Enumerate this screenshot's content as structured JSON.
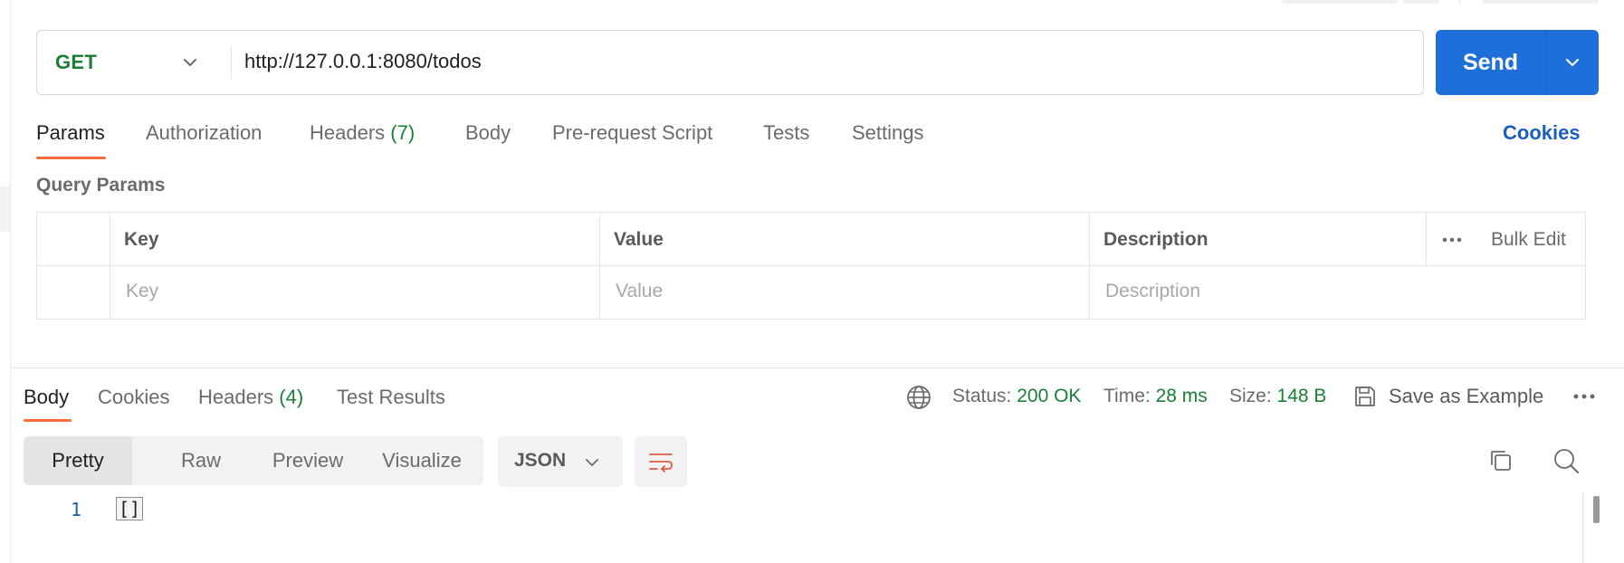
{
  "request": {
    "method": "GET",
    "url": "http://127.0.0.1:8080/todos",
    "send_label": "Send"
  },
  "request_tabs": {
    "params": "Params",
    "authorization": "Authorization",
    "headers": "Headers",
    "headers_count": "(7)",
    "body": "Body",
    "pre_request": "Pre-request Script",
    "tests": "Tests",
    "settings": "Settings",
    "cookies": "Cookies"
  },
  "query_params": {
    "title": "Query Params",
    "columns": {
      "key": "Key",
      "value": "Value",
      "description": "Description"
    },
    "bulk_edit": "Bulk Edit",
    "placeholders": {
      "key": "Key",
      "value": "Value",
      "description": "Description"
    }
  },
  "response_tabs": {
    "body": "Body",
    "cookies": "Cookies",
    "headers": "Headers",
    "headers_count": "(4)",
    "test_results": "Test Results"
  },
  "response_meta": {
    "status_label": "Status:",
    "status_value": "200 OK",
    "time_label": "Time:",
    "time_value": "28 ms",
    "size_label": "Size:",
    "size_value": "148 B",
    "save_example": "Save as Example"
  },
  "view_options": {
    "pretty": "Pretty",
    "raw": "Raw",
    "preview": "Preview",
    "visualize": "Visualize"
  },
  "format": "JSON",
  "code": {
    "line_number": "1",
    "content": "[]"
  },
  "colors": {
    "accent_orange": "#ff6c37",
    "send_blue": "#1f6fdb",
    "status_green": "#1a7f37",
    "link_blue": "#1a5fc0"
  },
  "icons": {
    "method_dropdown": "chevron-down-icon",
    "send_dropdown": "chevron-down-icon",
    "globe": "globe-icon",
    "save": "save-icon",
    "more": "more-horizontal-icon",
    "wrap": "wrap-lines-icon",
    "copy": "copy-icon",
    "search": "search-icon"
  }
}
